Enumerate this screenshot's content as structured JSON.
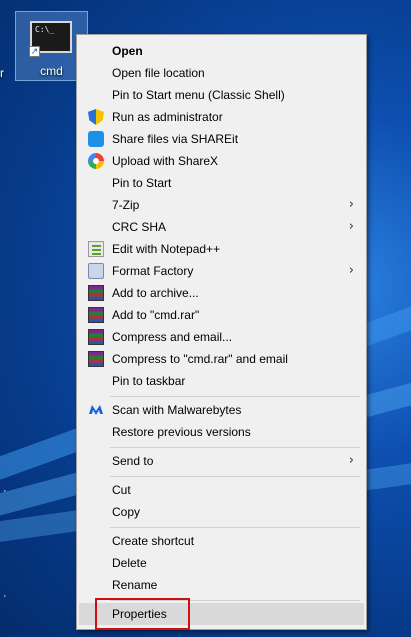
{
  "desktop": {
    "icon_label": "cmd",
    "cmd_preview": "C:\\_",
    "left_edge_text": "r"
  },
  "menu": {
    "items": [
      {
        "label": "Open",
        "bold": true
      },
      {
        "label": "Open file location"
      },
      {
        "label": "Pin to Start menu (Classic Shell)"
      },
      {
        "label": "Run as administrator",
        "icon": "shield-icon"
      },
      {
        "label": "Share files via SHAREit",
        "icon": "shareit-icon"
      },
      {
        "label": "Upload with ShareX",
        "icon": "sharex-icon"
      },
      {
        "label": "Pin to Start"
      },
      {
        "label": "7-Zip",
        "submenu": true
      },
      {
        "label": "CRC SHA",
        "submenu": true
      },
      {
        "label": "Edit with Notepad++",
        "icon": "notepadpp-icon"
      },
      {
        "label": "Format Factory",
        "icon": "formatfactory-icon",
        "submenu": true
      },
      {
        "label": "Add to archive...",
        "icon": "winrar-icon"
      },
      {
        "label": "Add to \"cmd.rar\"",
        "icon": "winrar-icon"
      },
      {
        "label": "Compress and email...",
        "icon": "winrar-icon"
      },
      {
        "label": "Compress to \"cmd.rar\" and email",
        "icon": "winrar-icon"
      },
      {
        "label": "Pin to taskbar"
      },
      {
        "label": "Scan with Malwarebytes",
        "icon": "malwarebytes-icon"
      },
      {
        "label": "Restore previous versions"
      },
      {
        "label": "Send to",
        "submenu": true
      },
      {
        "label": "Cut"
      },
      {
        "label": "Copy"
      },
      {
        "label": "Create shortcut"
      },
      {
        "label": "Delete"
      },
      {
        "label": "Rename"
      },
      {
        "label": "Properties",
        "highlighted": true
      }
    ],
    "submenu_arrow": "›"
  },
  "colors": {
    "highlight_border": "#d01010",
    "menu_background": "#f0f0f0"
  }
}
